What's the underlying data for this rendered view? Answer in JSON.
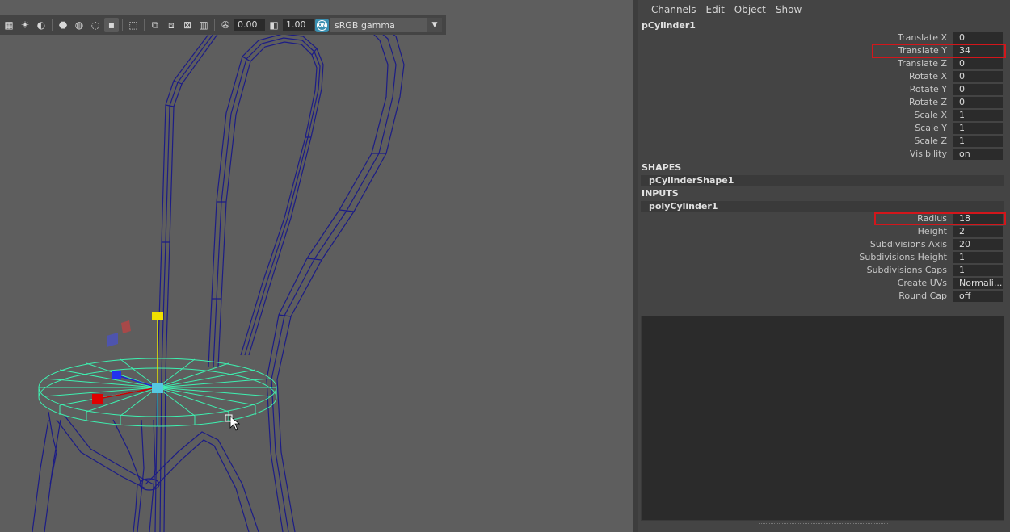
{
  "toolbar": {
    "exposure_value": "0.00",
    "gamma_value": "1.00",
    "on_badge": "ON",
    "color_space": "sRGB gamma",
    "icons": [
      "checker-icon",
      "light-icon",
      "shadow-icon",
      "ao-icon",
      "motion-blur-icon",
      "aa-icon",
      "isolate-icon",
      "select-icon",
      "xray-icon",
      "wire-icon",
      "resolution-gate-icon",
      "film-gate-icon",
      "exposure-icon",
      "gamma-icon"
    ]
  },
  "channel_box": {
    "menu": [
      "Channels",
      "Edit",
      "Object",
      "Show"
    ],
    "node_name": "pCylinder1",
    "transform_attrs": [
      {
        "label": "Translate X",
        "value": "0"
      },
      {
        "label": "Translate Y",
        "value": "34"
      },
      {
        "label": "Translate Z",
        "value": "0"
      },
      {
        "label": "Rotate X",
        "value": "0"
      },
      {
        "label": "Rotate Y",
        "value": "0"
      },
      {
        "label": "Rotate Z",
        "value": "0"
      },
      {
        "label": "Scale X",
        "value": "1"
      },
      {
        "label": "Scale Y",
        "value": "1"
      },
      {
        "label": "Scale Z",
        "value": "1"
      },
      {
        "label": "Visibility",
        "value": "on"
      }
    ],
    "shapes_header": "SHAPES",
    "shape_node": "pCylinderShape1",
    "inputs_header": "INPUTS",
    "input_node": "polyCylinder1",
    "input_attrs": [
      {
        "label": "Radius",
        "value": "18"
      },
      {
        "label": "Height",
        "value": "2"
      },
      {
        "label": "Subdivisions Axis",
        "value": "20"
      },
      {
        "label": "Subdivisions Height",
        "value": "1"
      },
      {
        "label": "Subdivisions Caps",
        "value": "1"
      },
      {
        "label": "Create UVs",
        "value": "Normali..."
      },
      {
        "label": "Round Cap",
        "value": "off"
      }
    ]
  },
  "colors": {
    "wireframe": "#1a1a7a",
    "selection": "#3ef0b0",
    "highlight_box": "#d3161b",
    "viewport_bg": "#5e5e5e"
  }
}
